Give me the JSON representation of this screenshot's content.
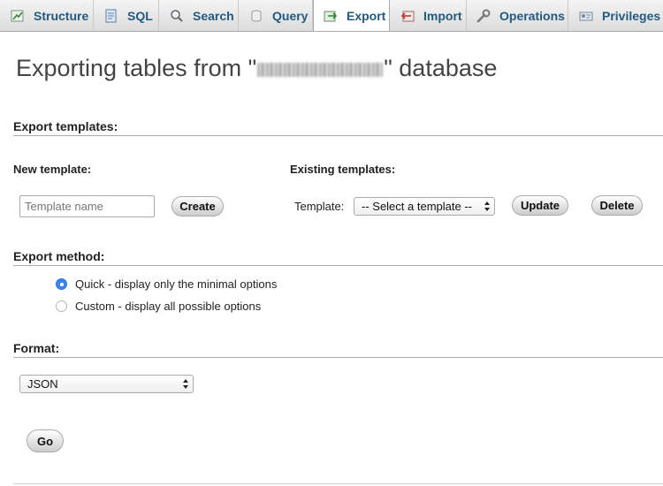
{
  "tabs": [
    {
      "label": "Structure",
      "icon": "structure-icon"
    },
    {
      "label": "SQL",
      "icon": "sql-icon"
    },
    {
      "label": "Search",
      "icon": "search-icon"
    },
    {
      "label": "Query",
      "icon": "query-icon"
    },
    {
      "label": "Export",
      "icon": "export-icon",
      "active": true
    },
    {
      "label": "Import",
      "icon": "import-icon"
    },
    {
      "label": "Operations",
      "icon": "wrench-icon"
    },
    {
      "label": "Privileges",
      "icon": "privileges-icon"
    }
  ],
  "page": {
    "title_prefix": "Exporting tables from \"",
    "title_suffix": "\" database"
  },
  "export_templates": {
    "heading": "Export templates:",
    "new_template_label": "New template:",
    "template_name_placeholder": "Template name",
    "create_label": "Create",
    "existing_templates_label": "Existing templates:",
    "template_label": "Template:",
    "template_select_value": "-- Select a template --",
    "update_label": "Update",
    "delete_label": "Delete"
  },
  "export_method": {
    "heading": "Export method:",
    "options": [
      {
        "label": "Quick - display only the minimal options",
        "selected": true
      },
      {
        "label": "Custom - display all possible options",
        "selected": false
      }
    ]
  },
  "format": {
    "heading": "Format:",
    "selected": "JSON"
  },
  "go_label": "Go",
  "colors": {
    "tab_text": "#235a81",
    "radio_selected": "#3b85f0",
    "rule": "#aaaaaa"
  }
}
